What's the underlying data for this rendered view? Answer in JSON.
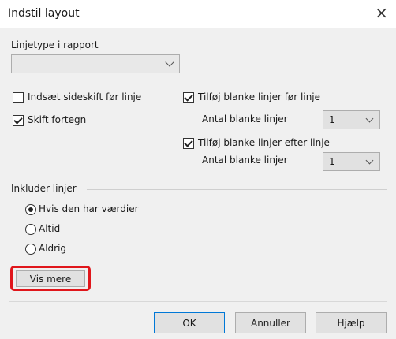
{
  "window": {
    "title": "Indstil layout",
    "close_glyph": "×"
  },
  "linjetype": {
    "label": "Linjetype i rapport",
    "value": ""
  },
  "options": {
    "insert_pagebreak": {
      "label": "Indsæt sideskift før linje",
      "checked": false
    },
    "switch_sign": {
      "label": "Skift fortegn",
      "checked": true
    },
    "blank_before": {
      "label": "Tilføj blanke linjer før linje",
      "checked": true,
      "count_label": "Antal blanke linjer",
      "count_value": "1"
    },
    "blank_after": {
      "label": "Tilføj blanke linjer efter linje",
      "checked": true,
      "count_label": "Antal blanke linjer",
      "count_value": "1"
    }
  },
  "include": {
    "label": "Inkluder linjer",
    "options": [
      {
        "label": "Hvis den har værdier",
        "selected": true
      },
      {
        "label": "Altid",
        "selected": false
      },
      {
        "label": "Aldrig",
        "selected": false
      }
    ]
  },
  "vis_mere": {
    "label": "Vis mere",
    "highlight_color": "#e0161b"
  },
  "buttons": {
    "ok": "OK",
    "cancel": "Annuller",
    "help": "Hjælp"
  },
  "colors": {
    "dialog_bg": "#f0f0f0",
    "title_bg": "#ffffff",
    "ok_border": "#0078d7"
  }
}
